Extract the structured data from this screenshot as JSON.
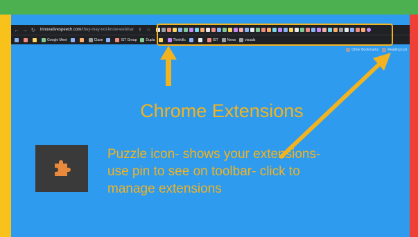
{
  "browser": {
    "url_domain": "innovativespeech.com",
    "url_path": "/they-may-not-know-webinar",
    "bookmarks": [
      "Google Meet",
      "Clase",
      "IST Group",
      "Dupla",
      "Thinkific",
      "IST",
      "News",
      "visuals"
    ],
    "bookmarks_right": [
      "Other Bookmarks",
      "Reading List"
    ]
  },
  "slide": {
    "title": "Chrome Extensions",
    "description": "Puzzle icon- shows your extensions-use pin to see on toolbar- click to manage extensions"
  },
  "icons": {
    "puzzle": "puzzle-piece-icon",
    "back": "back-arrow-icon",
    "forward": "forward-arrow-icon",
    "reload": "reload-icon"
  },
  "colors": {
    "slide_bg": "#2E9BEF",
    "accent": "#F2B320",
    "top_band": "#4CAF50",
    "left_band": "#F9C21B",
    "right_band": "#EE4036"
  }
}
